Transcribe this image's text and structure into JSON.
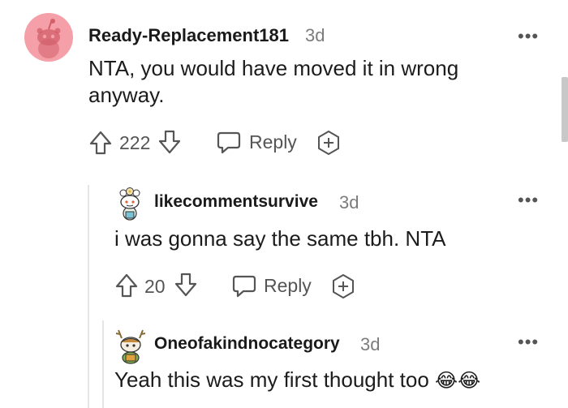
{
  "comments": [
    {
      "username": "Ready-Replacement181",
      "time": "3d",
      "body": "NTA, you would have moved it in wrong anyway.",
      "votes": "222",
      "reply_label": "Reply",
      "avatar": "reddit-snoo-avatar-pink"
    },
    {
      "username": "likecommentsurvive",
      "time": "3d",
      "body": "i was gonna say the same tbh. NTA",
      "votes": "20",
      "reply_label": "Reply",
      "avatar": "snoo-avatar-flower-hat"
    },
    {
      "username": "Oneofakindnocategory",
      "time": "3d",
      "body": "Yeah this was my first thought too",
      "emoji": "😂😂",
      "avatar": "snoo-avatar-antlers"
    }
  ],
  "more_menu": "•••",
  "colors": {
    "avatar_pink": "#f5a0a8",
    "icon_gray": "#555555",
    "thread_line": "#e5e5e5"
  }
}
